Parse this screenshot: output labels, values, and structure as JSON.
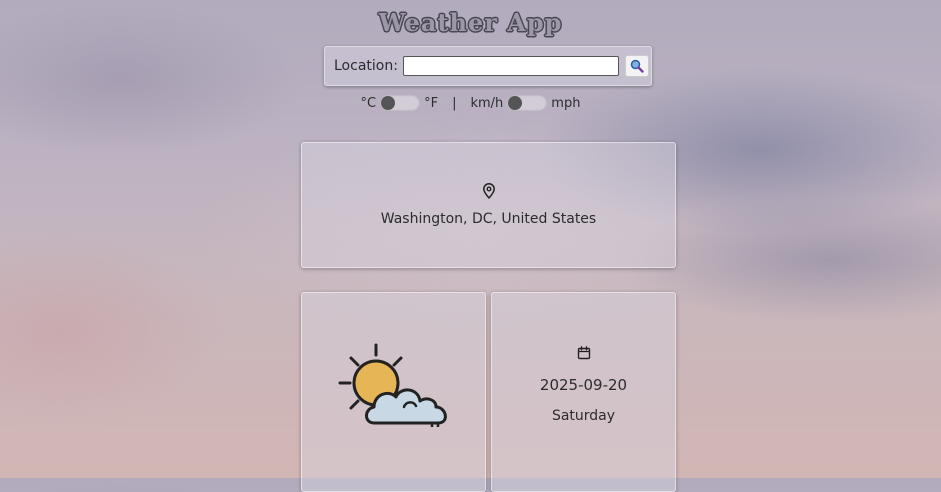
{
  "app": {
    "title": "Weather App"
  },
  "search": {
    "label": "Location:",
    "value": "",
    "placeholder": ""
  },
  "units": {
    "temp_celsius_label": "°C",
    "temp_fahrenheit_label": "°F",
    "separator": "|",
    "speed_kmh_label": "km/h",
    "speed_mph_label": "mph"
  },
  "location": {
    "name": "Washington, DC, United States",
    "icon": "map-pin-icon"
  },
  "weather": {
    "icon": "partly-cloudy-icon"
  },
  "date": {
    "value": "2025-09-20",
    "day": "Saturday",
    "icon": "calendar-icon"
  },
  "colors": {
    "sun": "#e6b556",
    "cloud": "#c8d8e4",
    "outline": "#222222"
  }
}
